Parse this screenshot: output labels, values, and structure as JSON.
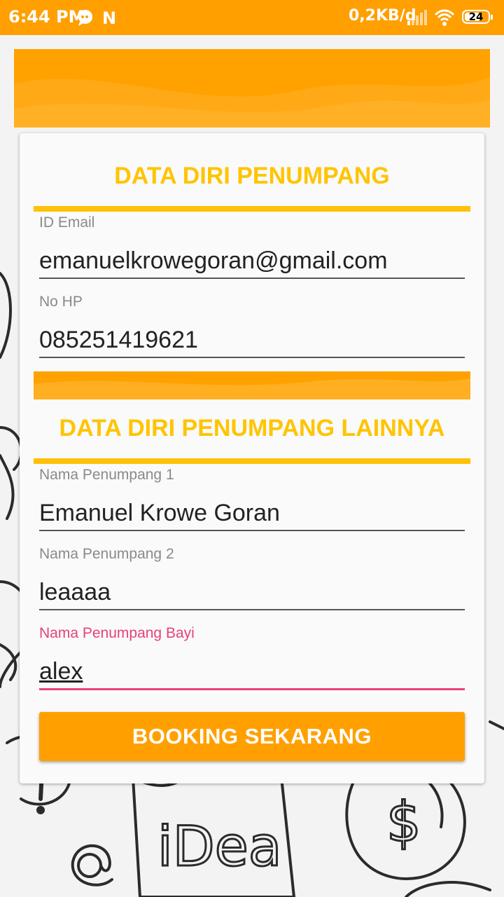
{
  "status_bar": {
    "time": "6:44 PM",
    "n_badge": "N",
    "data_speed": "0,2KB/d",
    "battery_level": "24",
    "icons": [
      "message-icon",
      "n-app-icon",
      "signal-icon",
      "wifi-icon",
      "battery-icon"
    ]
  },
  "section1": {
    "title": "DATA DIRI PENUMPANG",
    "email_label": "ID Email",
    "email_value": "emanuelkrowegoran@gmail.com",
    "phone_label": "No HP",
    "phone_value": "085251419621"
  },
  "section2": {
    "title": "DATA DIRI PENUMPANG LAINNYA",
    "passenger1_label": "Nama Penumpang 1",
    "passenger1_value": "Emanuel Krowe Goran",
    "passenger2_label": "Nama Penumpang 2",
    "passenger2_value": "leaaaa",
    "infant_label": "Nama Penumpang Bayi",
    "infant_value": "alex"
  },
  "booking_button_label": "BOOKING SEKARANG",
  "background_doodle_text": "iDea",
  "colors": {
    "primary_orange": "#ffa000",
    "title_yellow": "#ffc400",
    "active_pink": "#e8407a"
  }
}
